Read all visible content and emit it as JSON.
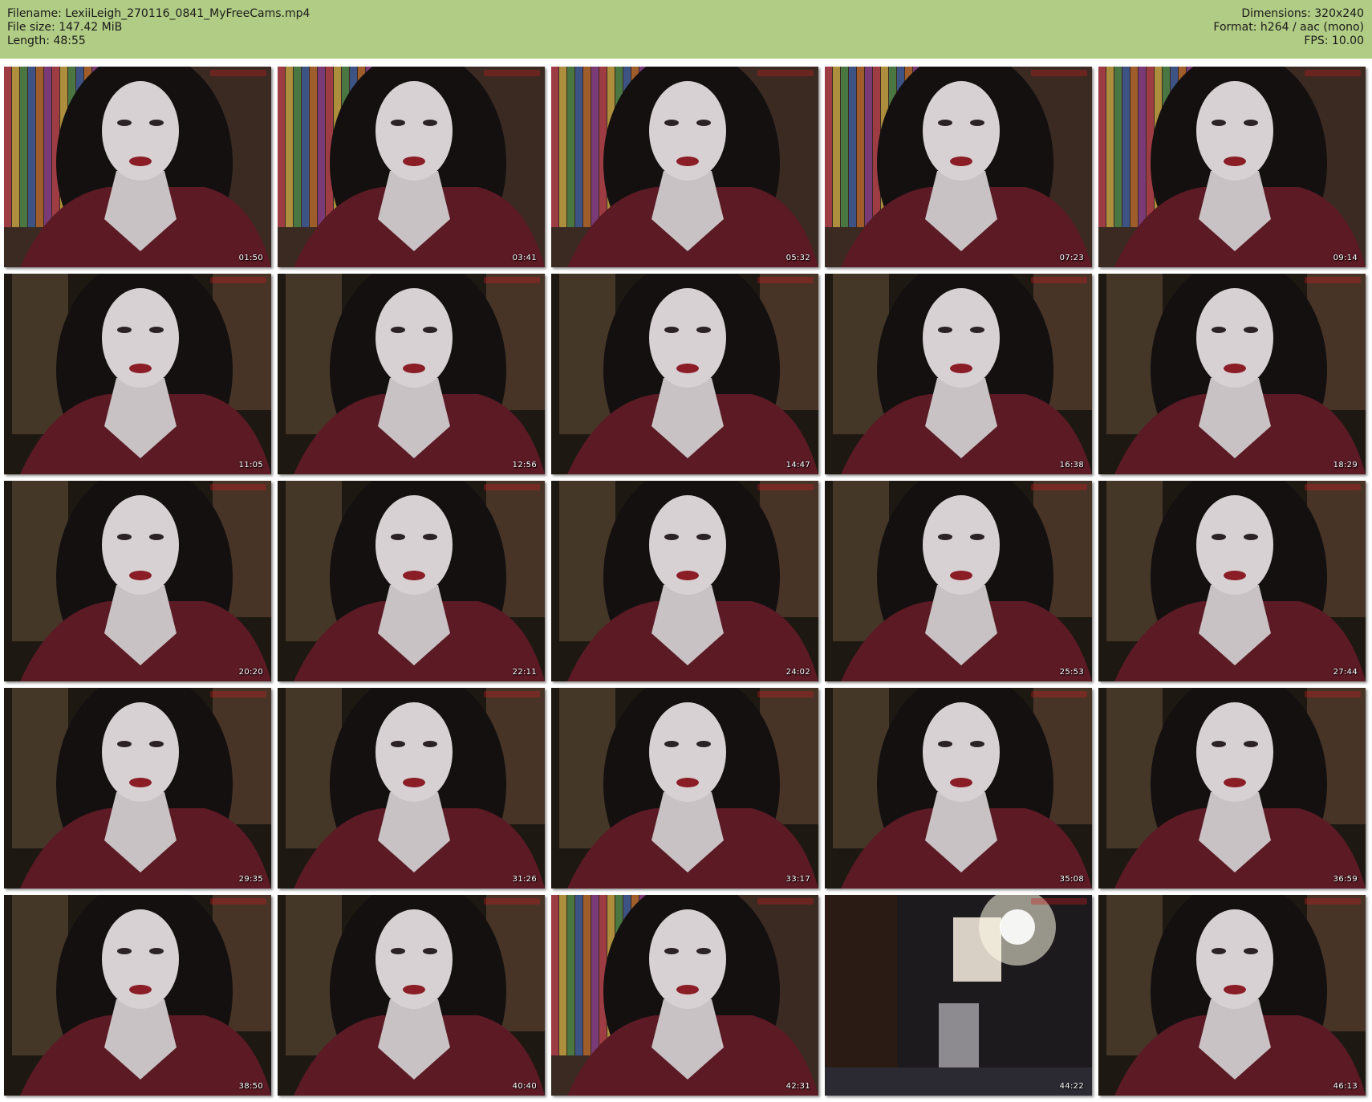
{
  "header": {
    "filename": "Filename: LexiiLeigh_270116_0841_MyFreeCams.mp4",
    "filesize": "File size: 147.42 MiB",
    "length": "Length: 48:55",
    "dimensions": "Dimensions: 320x240",
    "format": "Format: h264 / aac (mono)",
    "fps": "FPS: 10.00"
  },
  "colors": {
    "header_bg": "#b1cc85"
  },
  "thumbnails": [
    {
      "time": "01:50",
      "scene": "colorful-backdrop"
    },
    {
      "time": "03:41",
      "scene": "colorful-backdrop"
    },
    {
      "time": "05:32",
      "scene": "colorful-backdrop"
    },
    {
      "time": "07:23",
      "scene": "colorful-backdrop"
    },
    {
      "time": "09:14",
      "scene": "colorful-backdrop"
    },
    {
      "time": "11:05",
      "scene": "dim-room"
    },
    {
      "time": "12:56",
      "scene": "dim-room"
    },
    {
      "time": "14:47",
      "scene": "dim-room"
    },
    {
      "time": "16:38",
      "scene": "dim-room"
    },
    {
      "time": "18:29",
      "scene": "dim-room"
    },
    {
      "time": "20:20",
      "scene": "dim-room"
    },
    {
      "time": "22:11",
      "scene": "dim-room"
    },
    {
      "time": "24:02",
      "scene": "dim-room"
    },
    {
      "time": "25:53",
      "scene": "dim-room"
    },
    {
      "time": "27:44",
      "scene": "dim-room"
    },
    {
      "time": "29:35",
      "scene": "dim-room"
    },
    {
      "time": "31:26",
      "scene": "dim-room"
    },
    {
      "time": "33:17",
      "scene": "dim-room"
    },
    {
      "time": "35:08",
      "scene": "dim-room"
    },
    {
      "time": "36:59",
      "scene": "dim-room"
    },
    {
      "time": "38:50",
      "scene": "dim-room"
    },
    {
      "time": "40:40",
      "scene": "dim-room"
    },
    {
      "time": "42:31",
      "scene": "colorful-backdrop"
    },
    {
      "time": "44:22",
      "scene": "empty-room"
    },
    {
      "time": "46:13",
      "scene": "dim-room"
    }
  ]
}
